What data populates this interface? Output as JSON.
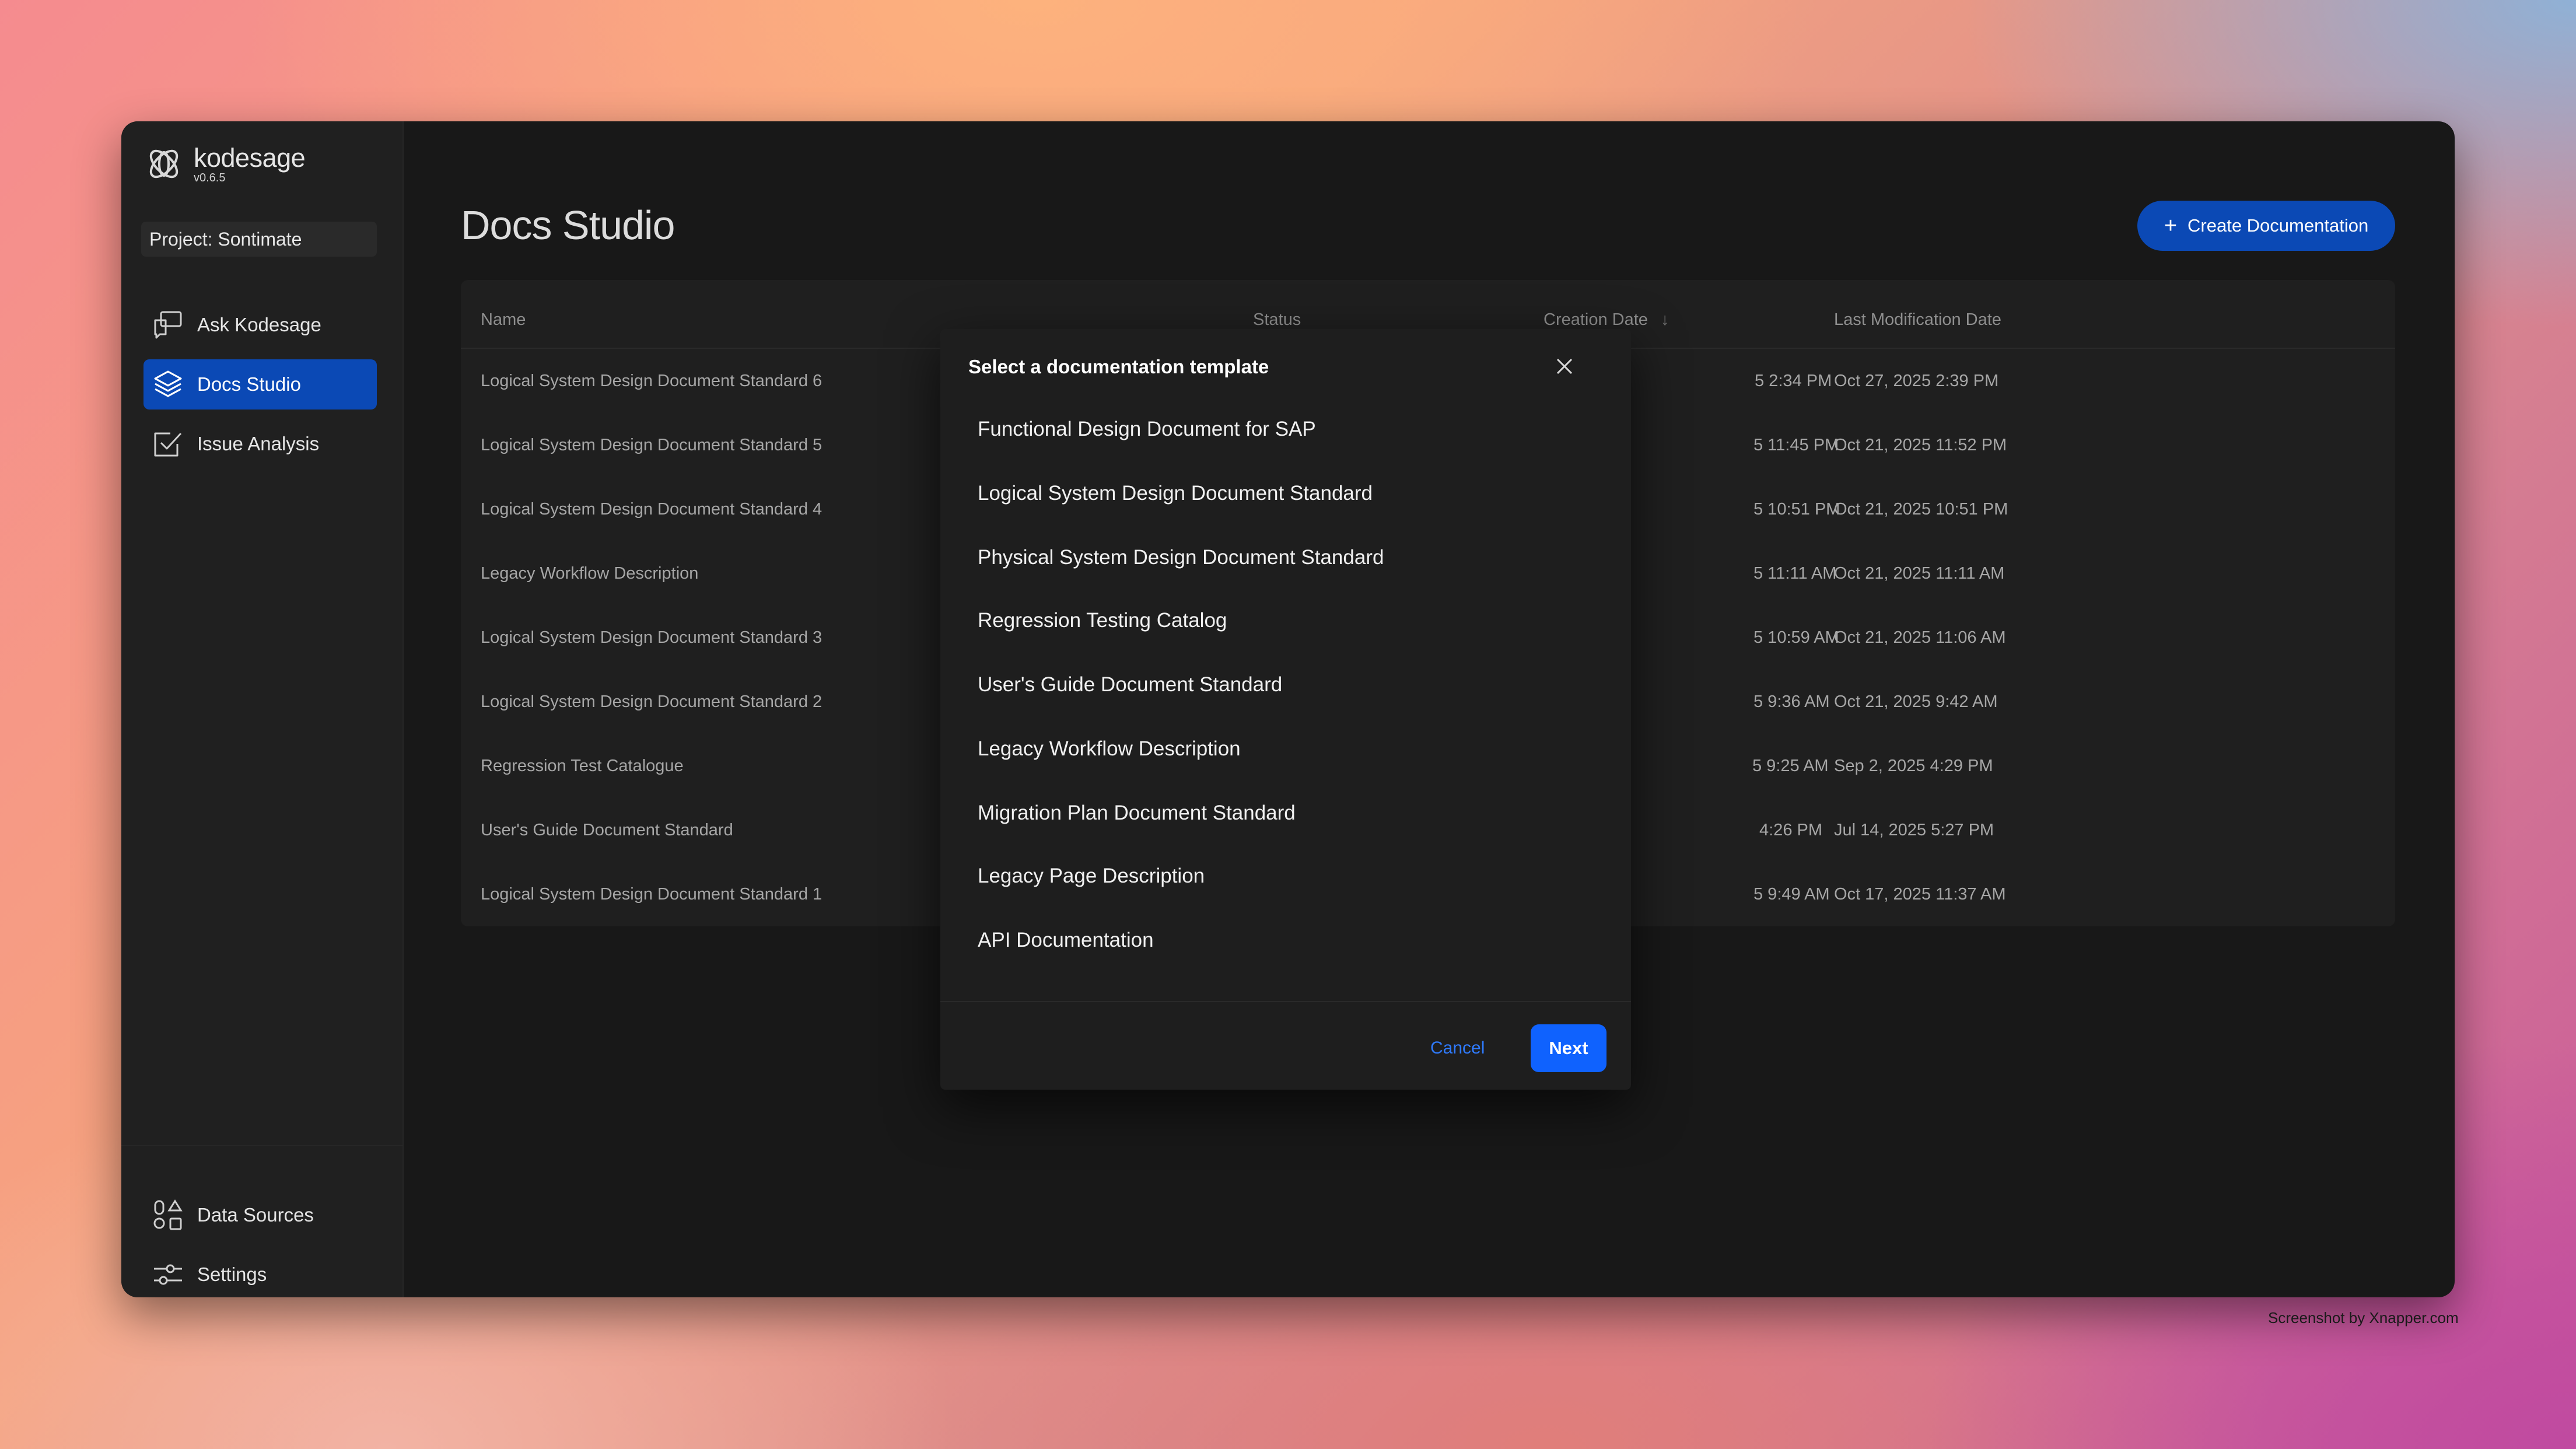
{
  "app": {
    "name": "kodesage",
    "version": "v0.6.5",
    "project": "Project: Sontimate"
  },
  "sidebar": {
    "items": [
      {
        "label": "Ask Kodesage",
        "icon": "chat-bubbles-icon"
      },
      {
        "label": "Docs Studio",
        "icon": "layers-icon",
        "active": true
      },
      {
        "label": "Issue Analysis",
        "icon": "checkbox-icon"
      }
    ],
    "bottom_items": [
      {
        "label": "Data Sources",
        "icon": "data-sources-icon"
      },
      {
        "label": "Settings",
        "icon": "sliders-icon"
      }
    ]
  },
  "header": {
    "title": "Docs Studio",
    "create_label": "Create Documentation"
  },
  "table": {
    "columns": [
      "Name",
      "Status",
      "Creation Date",
      "Last Modification Date"
    ],
    "sort_column": "Creation Date",
    "rows": [
      {
        "name": "Logical System Design Document Standard 6",
        "created": "5 2:34 PM",
        "modified": "Oct 27, 2025 2:39 PM"
      },
      {
        "name": "Logical System Design Document Standard 5",
        "created": "5 11:45 PM",
        "modified": "Oct 21, 2025 11:52 PM"
      },
      {
        "name": "Logical System Design Document Standard 4",
        "created": "5 10:51 PM",
        "modified": "Oct 21, 2025 10:51 PM"
      },
      {
        "name": "Legacy Workflow Description",
        "created": "5 11:11 AM",
        "modified": "Oct 21, 2025 11:11 AM"
      },
      {
        "name": "Logical System Design Document Standard 3",
        "created": "5 10:59 AM",
        "modified": "Oct 21, 2025 11:06 AM"
      },
      {
        "name": "Logical System Design Document Standard 2",
        "created": "5 9:36 AM",
        "modified": "Oct 21, 2025 9:42 AM"
      },
      {
        "name": "Regression Test Catalogue",
        "created": "5 9:25 AM",
        "modified": "Sep 2, 2025 4:29 PM"
      },
      {
        "name": "User's Guide Document Standard",
        "created": "4:26 PM",
        "modified": "Jul 14, 2025 5:27 PM"
      },
      {
        "name": "Logical System Design Document Standard 1",
        "created": "5 9:49 AM",
        "modified": "Oct 17, 2025 11:37 AM"
      }
    ]
  },
  "modal": {
    "title": "Select a documentation template",
    "templates": [
      "Functional Design Document for SAP",
      "Logical System Design Document Standard",
      "Physical System Design Document Standard",
      "Regression Testing Catalog",
      "User's Guide Document Standard",
      "Legacy Workflow Description",
      "Migration Plan Document Standard",
      "Legacy Page Description",
      "API Documentation"
    ],
    "cancel_label": "Cancel",
    "next_label": "Next"
  },
  "credit": "Screenshot by Xnapper.com",
  "colors": {
    "accent": "#0b49b5",
    "primary_button": "#0f62fe",
    "link": "#2f7bff",
    "background": "#181818"
  }
}
